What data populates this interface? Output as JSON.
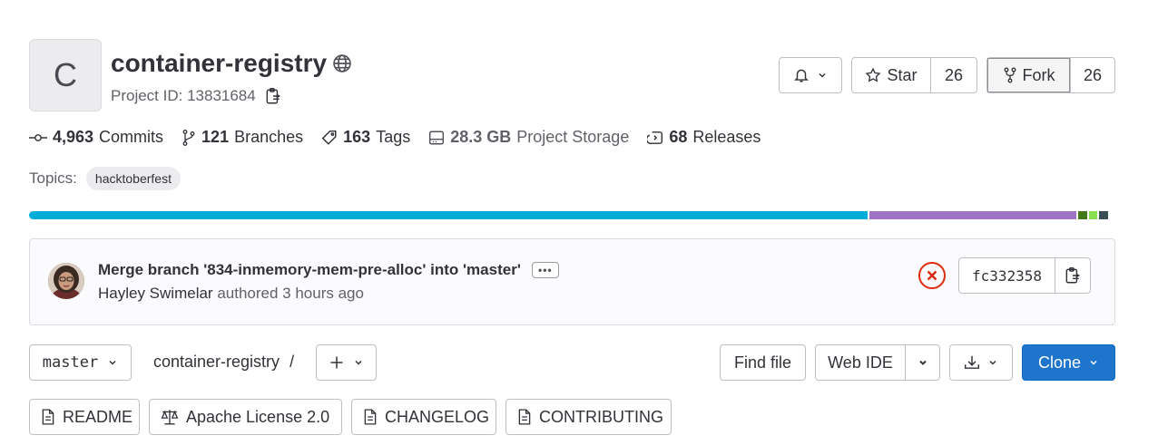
{
  "project": {
    "avatar_letter": "C",
    "name": "container-registry",
    "visibility_icon": "globe-icon",
    "id_label": "Project ID: 13831684"
  },
  "actions": {
    "notification_icon": "bell-icon",
    "star_label": "Star",
    "star_count": "26",
    "fork_label": "Fork",
    "fork_count": "26"
  },
  "stats": {
    "commits_count": "4,963",
    "commits_label": "Commits",
    "branches_count": "121",
    "branches_label": "Branches",
    "tags_count": "163",
    "tags_label": "Tags",
    "storage_size": "28.3 GB",
    "storage_label": "Project Storage",
    "releases_count": "68",
    "releases_label": "Releases"
  },
  "topics": {
    "label": "Topics:",
    "items": [
      "hacktoberfest"
    ]
  },
  "language_bar": {
    "segments": [
      {
        "color": "#00add8",
        "fraction": 0.777
      },
      {
        "color": "#a074c4",
        "fraction": 0.192
      },
      {
        "color": "#427819",
        "fraction": 0.008
      },
      {
        "color": "#89e051",
        "fraction": 0.008
      },
      {
        "color": "#384d54",
        "fraction": 0.008
      }
    ]
  },
  "last_commit": {
    "title": "Merge branch '834-inmemory-mem-pre-alloc' into 'master'",
    "author": "Hayley Swimelar",
    "meta": "authored 3 hours ago",
    "status": "failed",
    "sha": "fc332358"
  },
  "repo_toolbar": {
    "branch": "master",
    "path": "container-registry",
    "path_separator": "/",
    "find_file": "Find file",
    "web_ide": "Web IDE",
    "clone": "Clone"
  },
  "file_links": [
    {
      "label": "README",
      "icon": "document-icon"
    },
    {
      "label": "Apache License 2.0",
      "icon": "scale-icon"
    },
    {
      "label": "CHANGELOG",
      "icon": "document-icon"
    },
    {
      "label": "CONTRIBUTING",
      "icon": "document-icon"
    }
  ],
  "colors": {
    "accent_blue": "#1f75cb",
    "error_red": "#dd2b0e"
  }
}
